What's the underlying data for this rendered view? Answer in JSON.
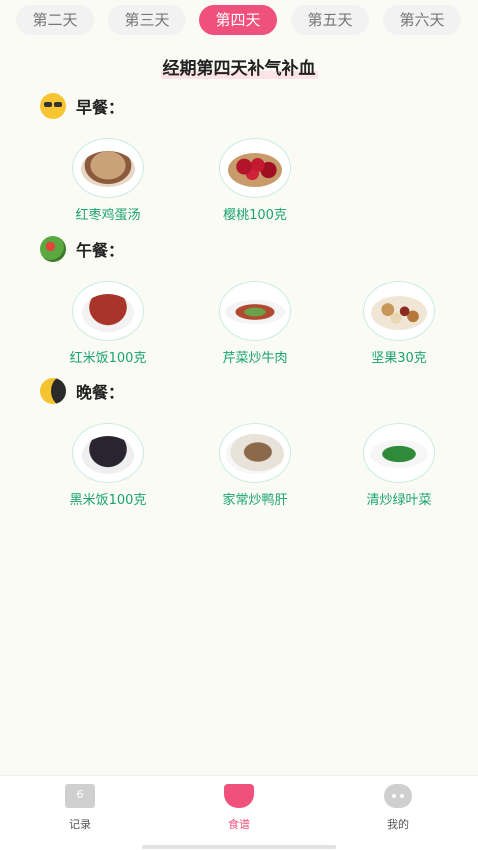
{
  "tabs": [
    {
      "label": "第二天",
      "active": false
    },
    {
      "label": "第三天",
      "active": false
    },
    {
      "label": "第四天",
      "active": true
    },
    {
      "label": "第五天",
      "active": false
    },
    {
      "label": "第六天",
      "active": false
    }
  ],
  "page_title": "经期第四天补气补血",
  "meals": [
    {
      "label": "早餐：",
      "icon": "sun-icon",
      "foods": [
        {
          "name": "红枣鸡蛋汤",
          "icon": "soup-icon"
        },
        {
          "name": "樱桃100克",
          "icon": "cherry-icon"
        }
      ]
    },
    {
      "label": "午餐：",
      "icon": "salad-icon",
      "foods": [
        {
          "name": "红米饭100克",
          "icon": "red-rice-icon"
        },
        {
          "name": "芹菜炒牛肉",
          "icon": "celery-beef-icon"
        },
        {
          "name": "坚果30克",
          "icon": "nuts-icon"
        }
      ]
    },
    {
      "label": "晚餐：",
      "icon": "moon-icon",
      "foods": [
        {
          "name": "黑米饭100克",
          "icon": "black-rice-icon"
        },
        {
          "name": "家常炒鸭肝",
          "icon": "duck-liver-icon"
        },
        {
          "name": "清炒绿叶菜",
          "icon": "greens-icon"
        }
      ]
    }
  ],
  "nav": [
    {
      "label": "记录",
      "icon": "calendar-icon",
      "badge": "6",
      "active": false
    },
    {
      "label": "食谱",
      "icon": "bowl-icon",
      "active": true
    },
    {
      "label": "我的",
      "icon": "chat-icon",
      "active": false
    }
  ],
  "colors": {
    "accent": "#f0507c",
    "food_text": "#1aa36f",
    "background": "#fbfbf6"
  }
}
